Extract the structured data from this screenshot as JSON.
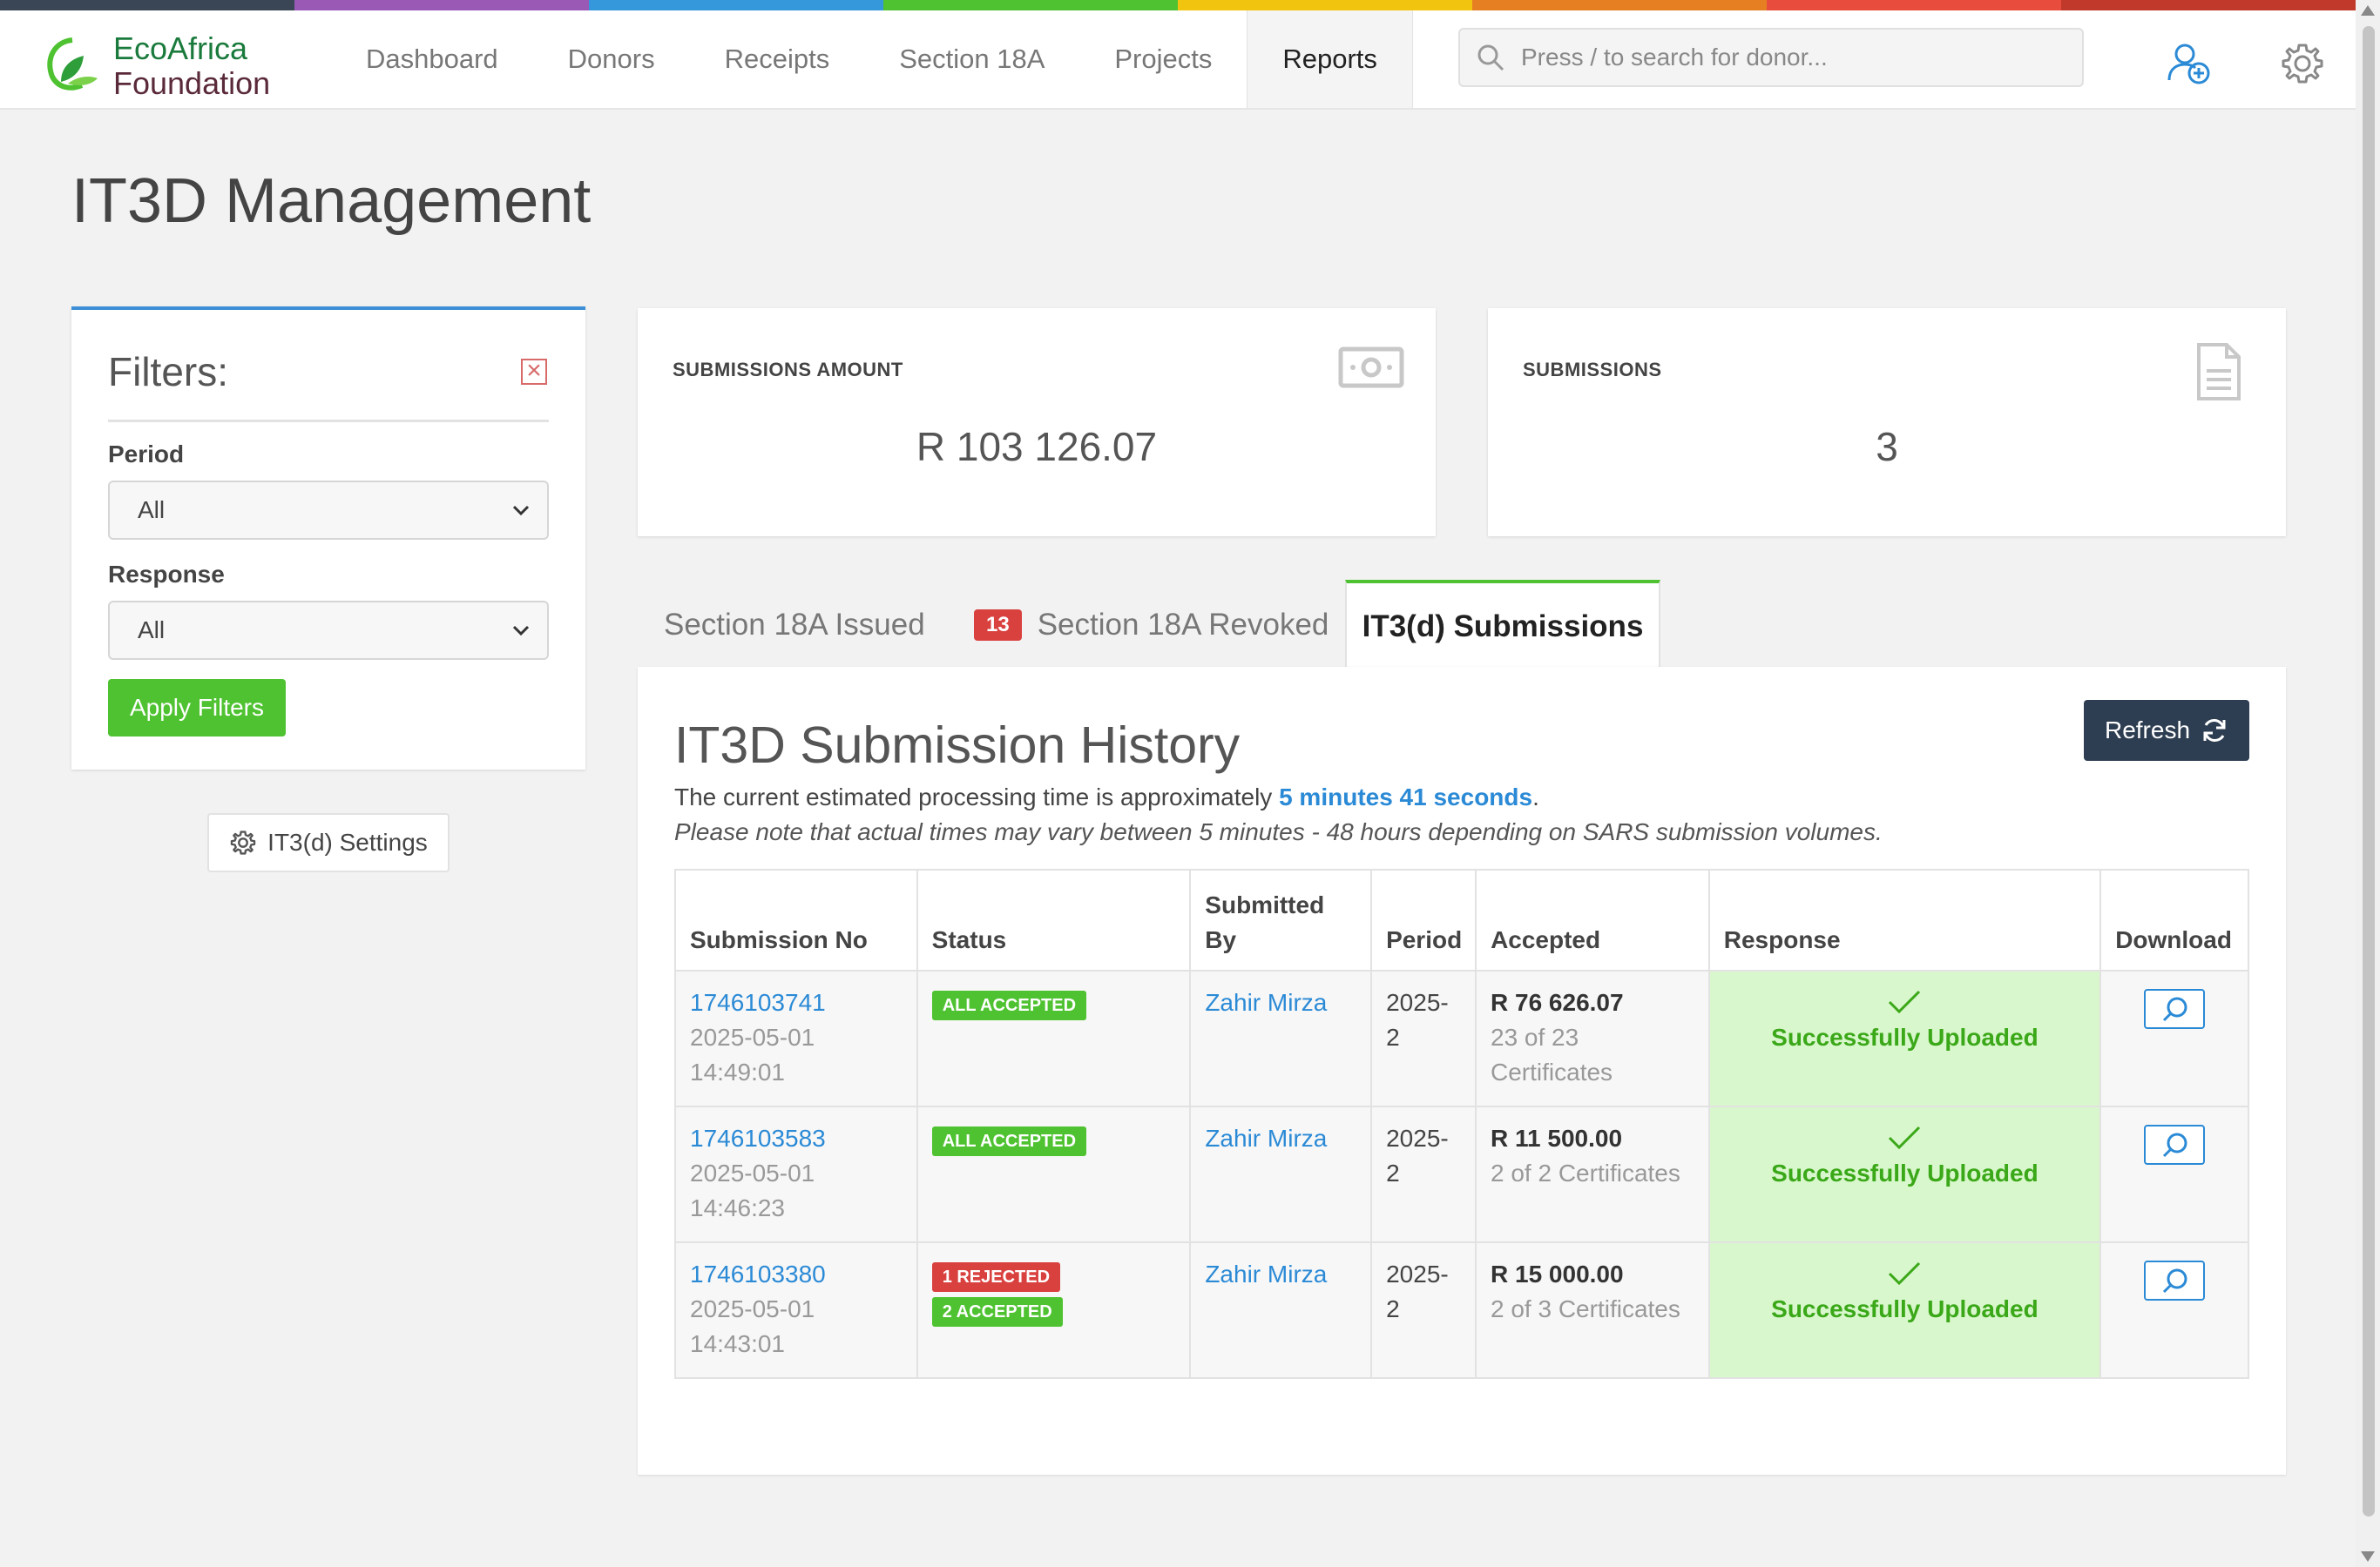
{
  "brand": {
    "line1": "EcoAfrica",
    "line2": "Foundation",
    "stripe_colors": [
      "#3a4656",
      "#9b59b6",
      "#3498db",
      "#4ec230",
      "#f1c40f",
      "#e67e22",
      "#e74c3c",
      "#c0392b"
    ]
  },
  "nav": {
    "items": [
      "Dashboard",
      "Donors",
      "Receipts",
      "Section 18A",
      "Projects",
      "Reports"
    ],
    "active": "Reports"
  },
  "search": {
    "placeholder": "Press / to search for donor..."
  },
  "header_icons": [
    "add-user-icon",
    "gear-icon"
  ],
  "page": {
    "title": "IT3D Management"
  },
  "filters": {
    "title": "Filters:",
    "period_label": "Period",
    "period_value": "All",
    "response_label": "Response",
    "response_value": "All",
    "apply_label": "Apply Filters",
    "settings_label": "IT3(d) Settings"
  },
  "stats": {
    "amount_label": "SUBMISSIONS AMOUNT",
    "amount_value": "R 103 126.07",
    "count_label": "SUBMISSIONS",
    "count_value": "3"
  },
  "tabs": {
    "issued": "Section 18A Issued",
    "revoked_badge": "13",
    "revoked": "Section 18A Revoked",
    "submissions": "IT3(d) Submissions"
  },
  "history": {
    "title": "IT3D Submission History",
    "refresh_label": "Refresh",
    "processing_prefix": "The current estimated processing time is approximately ",
    "processing_time": "5 minutes 41 seconds",
    "processing_suffix": ".",
    "note": "Please note that actual times may vary between 5 minutes - 48 hours depending on SARS submission volumes."
  },
  "table": {
    "headers": [
      "Submission No",
      "Status",
      "Submitted By",
      "Period",
      "Accepted",
      "Response",
      "Download"
    ],
    "rows": [
      {
        "submission_no": "1746103741",
        "date": "2025-05-01",
        "time": "14:49:01",
        "status_1": "ALL ACCEPTED",
        "status_2": "",
        "submitted_by": "Zahir Mirza",
        "period": "2025-2",
        "amount": "R 76 626.07",
        "certificates": "23 of 23 Certificates",
        "response": "Successfully Uploaded"
      },
      {
        "submission_no": "1746103583",
        "date": "2025-05-01",
        "time": "14:46:23",
        "status_1": "ALL ACCEPTED",
        "status_2": "",
        "submitted_by": "Zahir Mirza",
        "period": "2025-2",
        "amount": "R 11 500.00",
        "certificates": "2 of 2 Certificates",
        "response": "Successfully Uploaded"
      },
      {
        "submission_no": "1746103380",
        "date": "2025-05-01",
        "time": "14:43:01",
        "status_1": "1 REJECTED",
        "status_2": "2 ACCEPTED",
        "submitted_by": "Zahir Mirza",
        "period": "2025-2",
        "amount": "R 15 000.00",
        "certificates": "2 of 3 Certificates",
        "response": "Successfully Uploaded"
      }
    ]
  }
}
